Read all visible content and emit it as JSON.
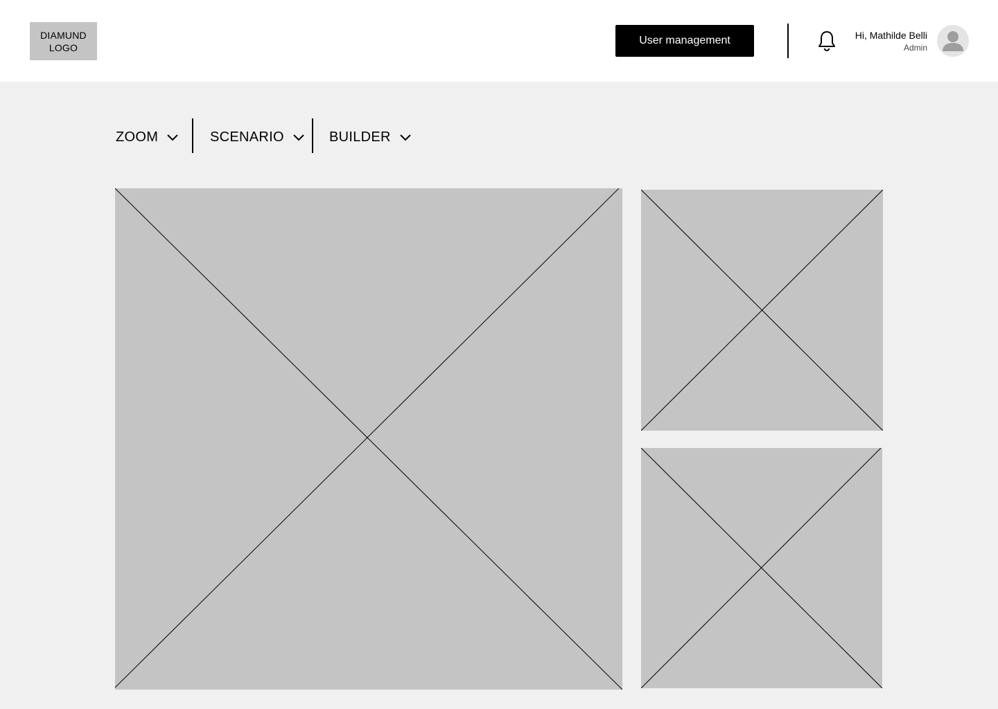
{
  "header": {
    "logo_line1": "DIAMUND",
    "logo_line2": "LOGO",
    "user_management_label": "User management",
    "user": {
      "greeting": "Hi, Mathilde Belli",
      "role": "Admin"
    },
    "icons": {
      "notifications": "bell-icon",
      "avatar": "user-avatar-icon"
    }
  },
  "nav": {
    "items": [
      {
        "label": "ZOOM",
        "icon": "chevron-down-icon"
      },
      {
        "label": "SCENARIO",
        "icon": "chevron-down-icon"
      },
      {
        "label": "BUILDER",
        "icon": "chevron-down-icon"
      }
    ]
  },
  "colors": {
    "page_background": "#f0f0f0",
    "header_background": "#ffffff",
    "placeholder": "#c4c4c4",
    "primary_button": "#000000"
  }
}
